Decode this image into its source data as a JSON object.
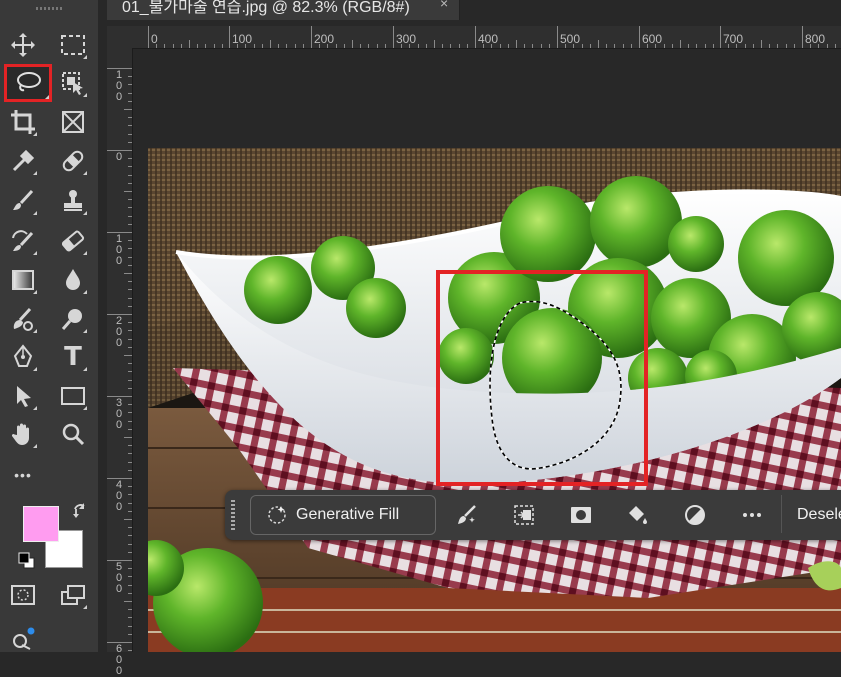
{
  "document": {
    "tab_title": "01_불가마술 연습.jpg @ 82.3% (RGB/8#)",
    "close_glyph": "×"
  },
  "ruler": {
    "horizontal_labels": [
      "0",
      "100",
      "200",
      "300",
      "400",
      "500",
      "600",
      "700",
      "800"
    ],
    "vertical_labels": [
      "100",
      "0",
      "100",
      "200",
      "300",
      "400",
      "500",
      "600"
    ]
  },
  "toolbar": {
    "tools": [
      {
        "name": "move-icon"
      },
      {
        "name": "rectangular-marquee-icon"
      },
      {
        "name": "lasso-icon",
        "selected": true
      },
      {
        "name": "object-selection-icon"
      },
      {
        "name": "crop-icon"
      },
      {
        "name": "frame-icon"
      },
      {
        "name": "eyedropper-icon"
      },
      {
        "name": "spot-healing-icon"
      },
      {
        "name": "brush-icon"
      },
      {
        "name": "clone-stamp-icon"
      },
      {
        "name": "history-brush-icon"
      },
      {
        "name": "eraser-icon"
      },
      {
        "name": "gradient-icon"
      },
      {
        "name": "blur-icon"
      },
      {
        "name": "smudge-icon"
      },
      {
        "name": "dodge-icon"
      },
      {
        "name": "pen-icon"
      },
      {
        "name": "type-icon"
      },
      {
        "name": "path-selection-icon"
      },
      {
        "name": "rectangle-shape-icon"
      },
      {
        "name": "hand-icon"
      },
      {
        "name": "zoom-icon"
      },
      {
        "name": "more-tools-icon"
      }
    ],
    "type_glyph": "T",
    "more_glyph": "•••",
    "foreground_color": "#ff9cf0",
    "background_color": "#ffffff"
  },
  "taskbar": {
    "generative_fill_label": "Generative Fill",
    "deselect_label": "Deselect",
    "icons": [
      "generative-brush-icon",
      "transform-selection-icon",
      "mask-icon",
      "fill-icon",
      "invert-icon",
      "more-options-icon"
    ]
  },
  "colors": {
    "selection_highlight": "#e32325",
    "panel_bg": "#393939",
    "accent_badge": "#2d8ceb"
  }
}
